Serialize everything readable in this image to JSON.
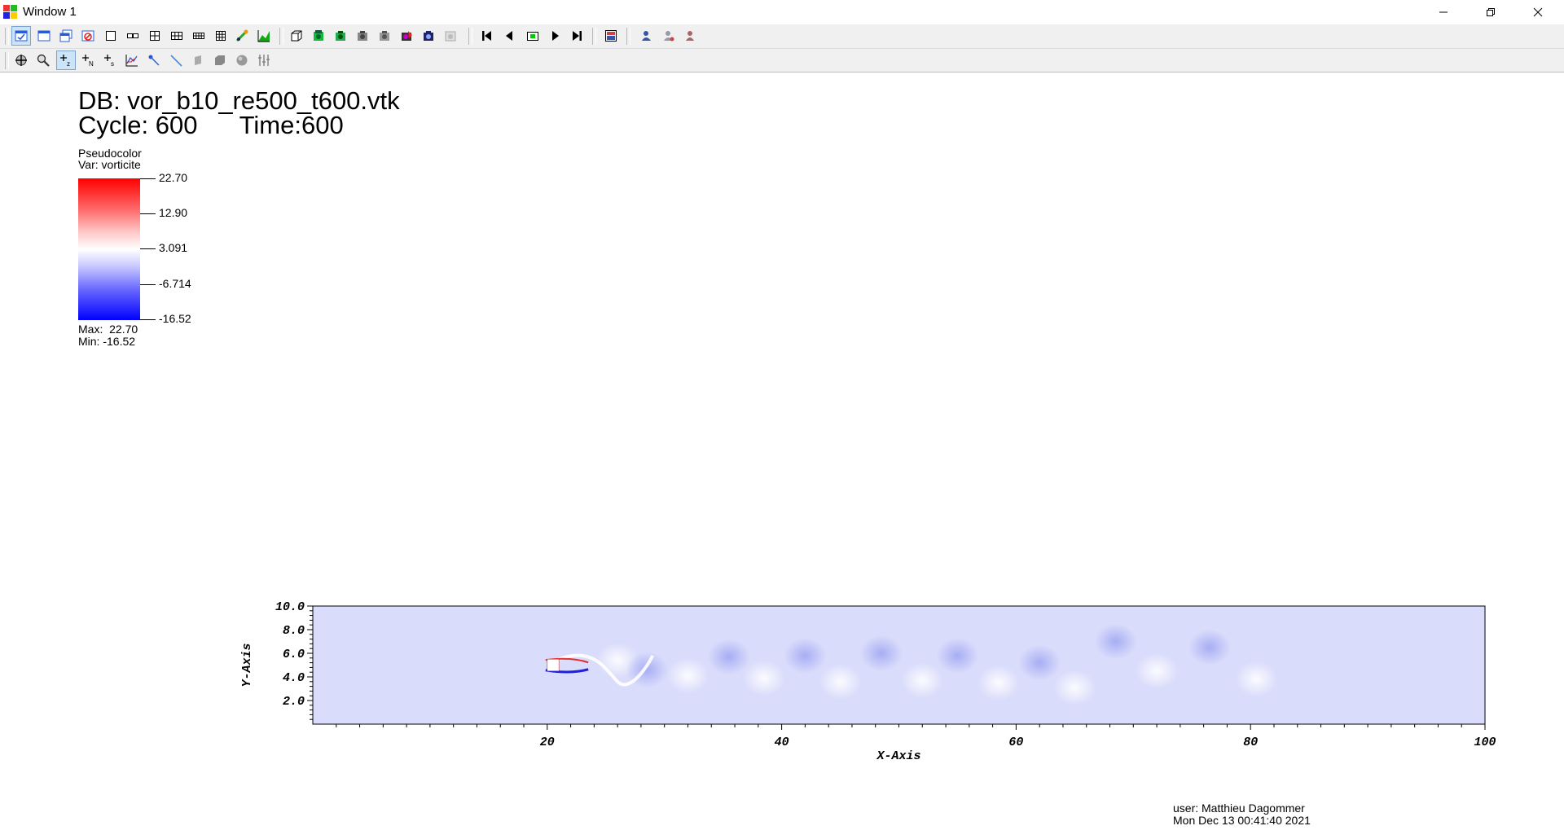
{
  "window": {
    "title": "Window 1",
    "controls": [
      "minimize-icon",
      "restore-icon",
      "close-icon"
    ]
  },
  "toolbar_top": {
    "buttons": [
      "active-window-icon",
      "new-window-icon",
      "clone-window-icon",
      "delete-window-icon",
      "layout-1x1-icon",
      "layout-1x2-icon",
      "layout-2x2-icon",
      "layout-2x3-icon",
      "layout-2x4-icon",
      "layout-3x3-icon",
      "invert-icon",
      "lineout-icon",
      "view-3d-icon",
      "draw-plots-icon",
      "hide-plots-icon",
      "delete-plots-icon",
      "clear-plots-icon",
      "animate-icon",
      "camera-icon",
      "reopen-icon",
      "frame-first-icon",
      "frame-back-icon",
      "stop-icon",
      "play-icon",
      "frame-last-icon",
      "save-image-icon",
      "engine-icon",
      "lock-view-icon",
      "lock-time-icon"
    ]
  },
  "toolbar_bottom": {
    "buttons": [
      "navigate-icon",
      "zoom-icon",
      "zone-pick-icon",
      "node-pick-icon",
      "spreadsheet-pick-icon",
      "lineout-tool-icon",
      "point-tool-icon",
      "line-tool-icon",
      "box-tool-icon",
      "plane-tool-icon",
      "sphere-tool-icon",
      "axis-tool-icon"
    ]
  },
  "header": {
    "db_line": "DB: vor_b10_re500_t600.vtk",
    "cycle_label": "Cycle:",
    "cycle_value": "600",
    "time_label": "Time:",
    "time_value": "600"
  },
  "legend": {
    "plot_type": "Pseudocolor",
    "variable": "Var: vorticite",
    "ticks": [
      "22.70",
      "12.90",
      "3.091",
      "-6.714",
      "-16.52"
    ],
    "max_text": "Max:  22.70",
    "min_text": "Min: -16.52",
    "colors": {
      "high": "#ff0000",
      "mid": "#ffffff",
      "low": "#0000ff"
    }
  },
  "chart_data": {
    "type": "heatmap",
    "title": "",
    "xlabel": "X-Axis",
    "ylabel": "Y-Axis",
    "xlim": [
      0,
      100
    ],
    "ylim": [
      0,
      10
    ],
    "xticks": [
      "20",
      "40",
      "60",
      "80",
      "100"
    ],
    "yticks": [
      "2.0",
      "4.0",
      "6.0",
      "8.0",
      "10.0"
    ],
    "x_minor_step": 2,
    "y_minor_step": 0.4,
    "obstacle": {
      "x": [
        20,
        21
      ],
      "y": [
        4.5,
        5.5
      ]
    },
    "background_color": "#dadcfb",
    "vortices": [
      {
        "x": 26.0,
        "y": 5.4,
        "sign": 1
      },
      {
        "x": 28.5,
        "y": 4.6,
        "sign": -1
      },
      {
        "x": 32.0,
        "y": 4.1,
        "sign": 1
      },
      {
        "x": 35.5,
        "y": 5.7,
        "sign": -1
      },
      {
        "x": 38.5,
        "y": 3.9,
        "sign": 1
      },
      {
        "x": 42.0,
        "y": 5.8,
        "sign": -1
      },
      {
        "x": 45.0,
        "y": 3.6,
        "sign": 1
      },
      {
        "x": 48.5,
        "y": 6.0,
        "sign": -1
      },
      {
        "x": 52.0,
        "y": 3.7,
        "sign": 1
      },
      {
        "x": 55.0,
        "y": 5.8,
        "sign": -1
      },
      {
        "x": 58.5,
        "y": 3.5,
        "sign": 1
      },
      {
        "x": 62.0,
        "y": 5.2,
        "sign": -1
      },
      {
        "x": 65.0,
        "y": 3.1,
        "sign": 1
      },
      {
        "x": 68.5,
        "y": 7.0,
        "sign": -1
      },
      {
        "x": 72.0,
        "y": 4.5,
        "sign": 1
      },
      {
        "x": 76.5,
        "y": 6.5,
        "sign": -1
      },
      {
        "x": 80.5,
        "y": 3.8,
        "sign": 1
      }
    ]
  },
  "footer": {
    "user": "user: Matthieu Dagommer",
    "datetime": "Mon Dec 13 00:41:40 2021"
  }
}
